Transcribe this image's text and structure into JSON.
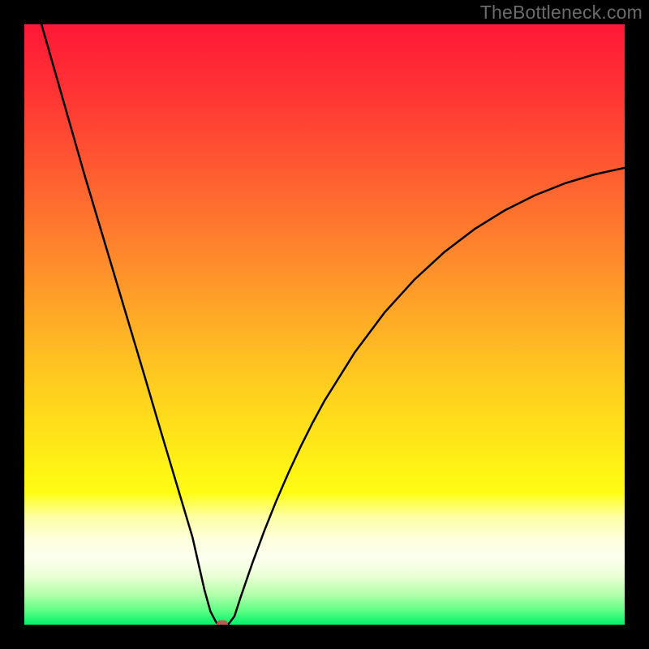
{
  "watermark": "TheBottleneck.com",
  "colors": {
    "frame": "#000000",
    "watermark": "#6b6b6b",
    "curve": "#000000",
    "marker": "#c15a52"
  },
  "gradient_stops": [
    {
      "offset": 0.0,
      "color": "#ff1837"
    },
    {
      "offset": 0.1,
      "color": "#ff3034"
    },
    {
      "offset": 0.2,
      "color": "#ff4e32"
    },
    {
      "offset": 0.3,
      "color": "#ff6d2f"
    },
    {
      "offset": 0.4,
      "color": "#ff8d2c"
    },
    {
      "offset": 0.5,
      "color": "#ffae26"
    },
    {
      "offset": 0.6,
      "color": "#ffcd1f"
    },
    {
      "offset": 0.7,
      "color": "#ffe818"
    },
    {
      "offset": 0.78,
      "color": "#fffd12"
    },
    {
      "offset": 0.82,
      "color": "#fdffa3"
    },
    {
      "offset": 0.86,
      "color": "#fdffe0"
    },
    {
      "offset": 0.89,
      "color": "#fcffee"
    },
    {
      "offset": 0.92,
      "color": "#e9ffd4"
    },
    {
      "offset": 0.95,
      "color": "#b2ffab"
    },
    {
      "offset": 0.975,
      "color": "#64ff86"
    },
    {
      "offset": 1.0,
      "color": "#00f36b"
    }
  ],
  "chart_data": {
    "type": "line",
    "title": "",
    "xlabel": "",
    "ylabel": "",
    "xlim": [
      0,
      100
    ],
    "ylim": [
      0,
      100
    ],
    "grid": false,
    "legend": false,
    "marker": {
      "x": 33,
      "y": 0
    },
    "series": [
      {
        "name": "bottleneck-curve",
        "x": [
          0,
          2,
          4,
          6,
          8,
          10,
          12,
          14,
          16,
          18,
          20,
          22,
          24,
          26,
          28,
          30,
          31,
          32,
          33,
          34,
          35,
          36,
          38,
          40,
          42,
          44,
          46,
          48,
          50,
          55,
          60,
          65,
          70,
          75,
          80,
          85,
          90,
          95,
          100
        ],
        "y": [
          110,
          103,
          96,
          89,
          82,
          75,
          68.3,
          61.6,
          54.9,
          48.2,
          41.5,
          34.7,
          28,
          21.3,
          14.6,
          5.8,
          2.2,
          0.3,
          0.1,
          0.1,
          1.4,
          4.5,
          10.3,
          15.7,
          20.7,
          25.3,
          29.6,
          33.6,
          37.3,
          45.3,
          52,
          57.5,
          62.1,
          65.9,
          69,
          71.5,
          73.5,
          75,
          76.1
        ]
      }
    ]
  }
}
